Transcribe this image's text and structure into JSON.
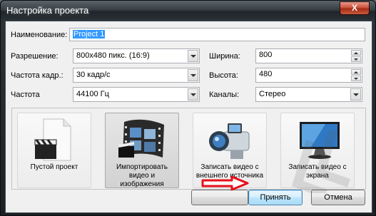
{
  "window": {
    "title": "Настройка проекта",
    "close_glyph": "X"
  },
  "form": {
    "name_label": "Наименование:",
    "name_value": "Project 1",
    "resolution_label": "Разрешение:",
    "resolution_value": "800x480 пикс. (16:9)",
    "framerate_label": "Частота кадр.:",
    "framerate_value": "30 кадр/с",
    "frequency_label": "Частота",
    "frequency_value": "44100 Гц",
    "width_label": "Ширина:",
    "width_value": "800",
    "height_label": "Высота:",
    "height_value": "480",
    "channels_label": "Каналы:",
    "channels_value": "Стерео"
  },
  "tiles": [
    {
      "caption": "Пустой проект",
      "icon": "clapperboard-document-icon"
    },
    {
      "caption": "Импортировать\nвидео и изображения",
      "icon": "film-strip-icon"
    },
    {
      "caption": "Записать видео с\nвнешнего источника",
      "icon": "camcorder-icon"
    },
    {
      "caption": "Записать видео с\nэкрана",
      "icon": "monitor-icon"
    }
  ],
  "buttons": {
    "ok": "Принять",
    "cancel": "Отмена"
  },
  "colors": {
    "selection": "#3399ff",
    "arrow": "#e8101a",
    "titlebar": "#2a3237"
  }
}
